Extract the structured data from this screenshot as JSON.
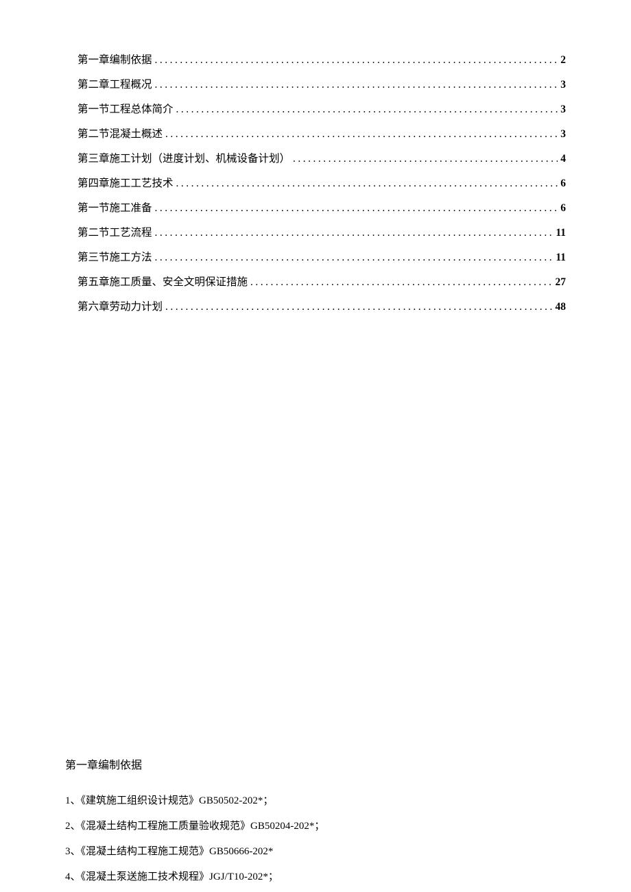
{
  "toc": [
    {
      "title": "第一章编制依据",
      "page": "2"
    },
    {
      "title": "第二章工程概况",
      "page": "3"
    },
    {
      "title": "第一节工程总体简介",
      "page": "3"
    },
    {
      "title": "第二节混凝土概述",
      "page": "3"
    },
    {
      "title": "第三章施工计划（进度计划、机械设备计划）",
      "page": "4"
    },
    {
      "title": "第四章施工工艺技术",
      "page": "6"
    },
    {
      "title": "第一节施工准备",
      "page": "6"
    },
    {
      "title": "第二节工艺流程",
      "page": "11"
    },
    {
      "title": "第三节施工方法",
      "page": "11"
    },
    {
      "title": "第五章施工质量、安全文明保证措施",
      "page": "27"
    },
    {
      "title": "第六章劳动力计划",
      "page": "48"
    }
  ],
  "chapter_heading": "第一章编制依据",
  "references": [
    {
      "num": "1",
      "sep": "、",
      "text_pre": "《建筑施工组织设计规范》",
      "code": "GB50502-202*",
      "text_post": "；"
    },
    {
      "num": "2",
      "sep": "、",
      "text_pre": "《混凝土结构工程施工质量验收规范》",
      "code": "GB50204-202*",
      "text_post": "；"
    },
    {
      "num": "3",
      "sep": "、",
      "text_pre": "《混凝土结构工程施工规范》",
      "code": "GB50666-202*",
      "text_post": ""
    },
    {
      "num": "4",
      "sep": "、",
      "text_pre": "《混凝土泵送施工技术规程》",
      "code": "JGJ/T10-202*",
      "text_post": "；"
    }
  ]
}
